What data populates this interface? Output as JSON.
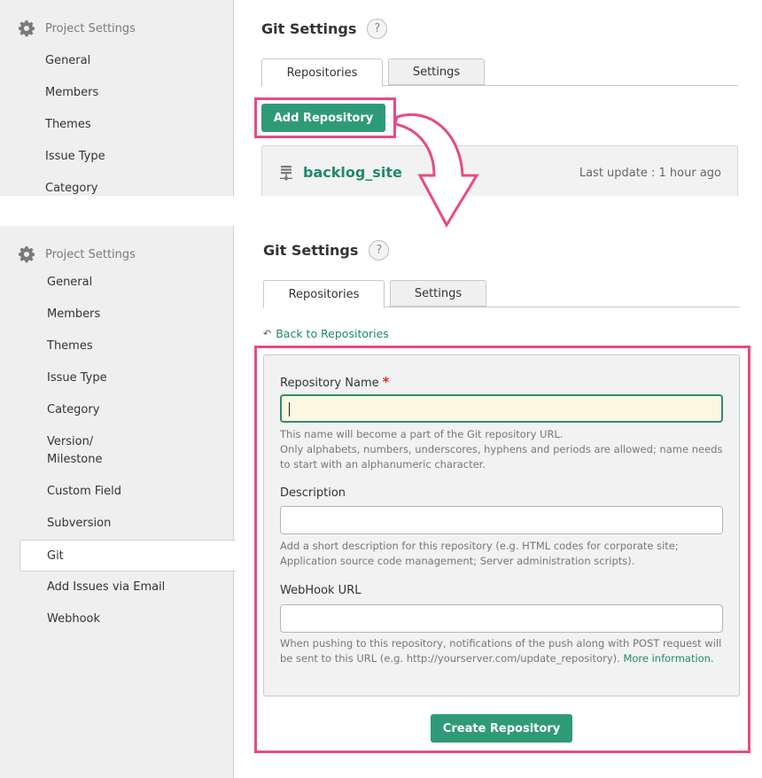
{
  "colors": {
    "accent_green": "#2f9a78",
    "link_green": "#1e8a6c",
    "highlight_pink": "#e84a85",
    "required_red": "#e0321c"
  },
  "sidebar": {
    "header": {
      "icon": "gear-icon",
      "label": "Project Settings"
    },
    "items_top": [
      "General",
      "Members",
      "Themes",
      "Issue Type",
      "Category"
    ],
    "items": [
      "General",
      "Members",
      "Themes",
      "Issue Type",
      "Category",
      "Version/",
      "Milestone",
      "Custom Field",
      "Subversion",
      "Git",
      "Add Issues via Email",
      "Webhook"
    ],
    "active_item": "Git"
  },
  "top": {
    "title": "Git Settings",
    "help_icon": "?",
    "tabs": [
      {
        "label": "Repositories",
        "active": true
      },
      {
        "label": "Settings",
        "active": false
      }
    ],
    "add_repository_label": "Add Repository",
    "repository": {
      "icon": "server-icon",
      "name": "backlog_site",
      "last_update": "Last update : 1 hour ago"
    }
  },
  "bottom": {
    "title": "Git Settings",
    "help_icon": "?",
    "tabs": [
      {
        "label": "Repositories",
        "active": true
      },
      {
        "label": "Settings",
        "active": false
      }
    ],
    "back_link": {
      "icon": "undo-icon",
      "label": "Back to Repositories"
    },
    "form": {
      "repo_name": {
        "label": "Repository Name",
        "required_mark": "*",
        "value": "",
        "hint_line1": "This name will become a part of the Git repository URL.",
        "hint_line2": "Only alphabets, numbers, underscores, hyphens and periods are allowed; name needs to start with an alphanumeric character."
      },
      "description": {
        "label": "Description",
        "value": "",
        "hint": "Add a short description for this repository (e.g. HTML codes for corporate site; Application source code management; Server administration scripts)."
      },
      "webhook": {
        "label": "WebHook URL",
        "value": "",
        "hint": "When pushing to this repository, notifications of the push along with POST request will be sent to this URL (e.g. http://yourserver.com/update_repository).",
        "more_link": "More information."
      }
    },
    "create_label": "Create Repository"
  }
}
